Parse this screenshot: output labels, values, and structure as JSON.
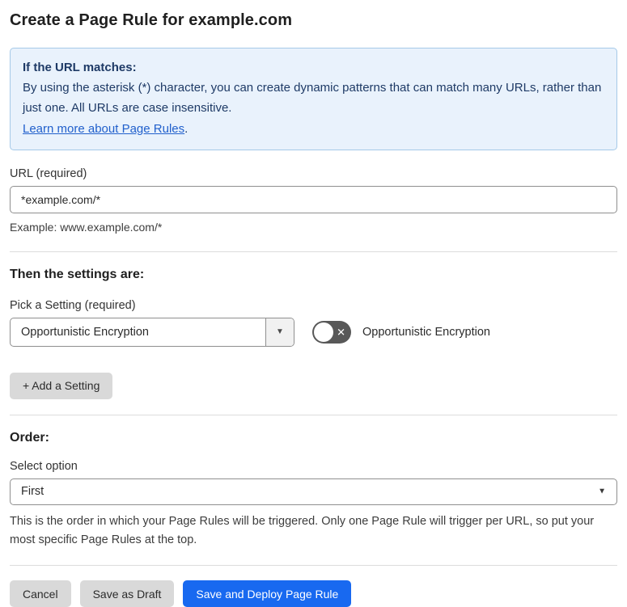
{
  "page": {
    "title": "Create a Page Rule for example.com"
  },
  "info_box": {
    "heading": "If the URL matches:",
    "body": "By using the asterisk (*) character, you can create dynamic patterns that can match many URLs, rather than just one. All URLs are case insensitive.",
    "link_label": "Learn more about Page Rules",
    "link_suffix": "."
  },
  "url_field": {
    "label": "URL (required)",
    "value": "*example.com/*",
    "helper": "Example: www.example.com/*"
  },
  "settings": {
    "heading": "Then the settings are:",
    "picker_label": "Pick a Setting (required)",
    "selected_setting": "Opportunistic Encryption",
    "toggle_label": "Opportunistic Encryption",
    "toggle_state": "off",
    "add_button_label": "+ Add a Setting"
  },
  "order": {
    "heading": "Order:",
    "select_label": "Select option",
    "selected_option": "First",
    "helper": "This is the order in which your Page Rules will be triggered. Only one Page Rule will trigger per URL, so put your most specific Page Rules at the top."
  },
  "footer": {
    "cancel_label": "Cancel",
    "save_draft_label": "Save as Draft",
    "save_deploy_label": "Save and Deploy Page Rule"
  },
  "icons": {
    "dropdown_arrow": "▼",
    "toggle_off_x": "✕"
  },
  "colors": {
    "primary_blue": "#1869f0",
    "info_bg": "#e9f2fc",
    "info_border": "#a5c9e8",
    "info_text": "#1e3a66",
    "link_blue": "#2160cc",
    "toggle_off_bg": "#585858",
    "gray_button_bg": "#d9d9d9"
  }
}
